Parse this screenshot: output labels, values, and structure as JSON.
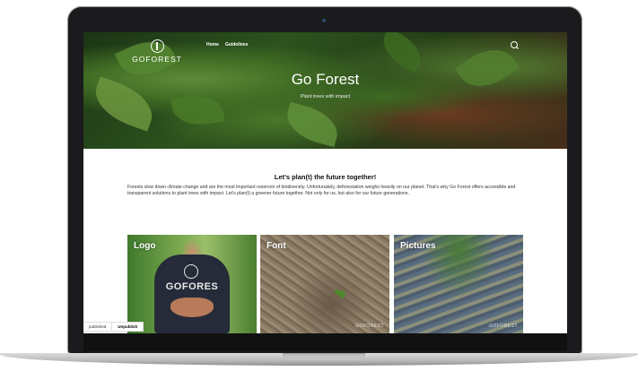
{
  "site": {
    "logo_text": "GOFOREST",
    "nav": [
      "Home",
      "Guidelines"
    ]
  },
  "hero": {
    "title": "Go Forest",
    "subtitle": "Plant trees with impact"
  },
  "content": {
    "heading": "Let’s plan(t) the future together!",
    "body": "Forests slow down climate change and are the most important reservoir of biodiversity. Unfortunately, deforestation weighs heavily on our planet. That’s why Go Forest offers accessible and transparent solutions to plant trees with impact. Let’s plan(t) a greener future together. Not only for us, but also for our future generations."
  },
  "cards": [
    {
      "label": "Logo",
      "shirt_text": "GOFORES"
    },
    {
      "label": "Font",
      "watermark": "GOFOREST"
    },
    {
      "label": "Pictures",
      "watermark": "GOFOREST"
    }
  ],
  "publish_bar": {
    "status": "published",
    "button": "Unpublish"
  }
}
